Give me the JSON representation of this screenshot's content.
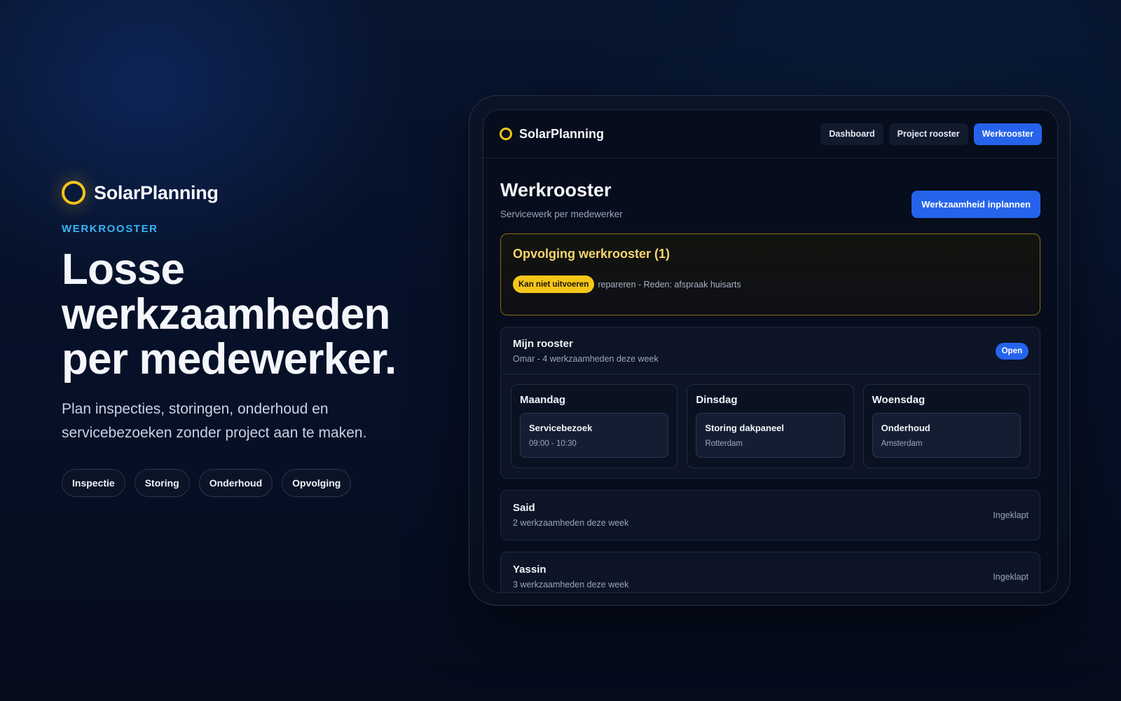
{
  "hero": {
    "brand": "SolarPlanning",
    "eyebrow": "WERKROOSTER",
    "headline": [
      "Losse",
      "werkzaamheden",
      "per medewerker."
    ],
    "lede": "Plan inspecties, storingen, onderhoud en servicebezoeken zonder project aan te maken.",
    "chips": [
      "Inspectie",
      "Storing",
      "Onderhoud",
      "Opvolging"
    ]
  },
  "app": {
    "brand": "SolarPlanning",
    "nav": [
      {
        "label": "Dashboard",
        "active": false
      },
      {
        "label": "Project rooster",
        "active": false
      },
      {
        "label": "Werkrooster",
        "active": true
      }
    ],
    "page": {
      "title": "Werkrooster",
      "subtitle": "Servicewerk per medewerker",
      "primary_action": "Werkzaamheid inplannen"
    },
    "followup": {
      "title": "Opvolging werkrooster (1)",
      "badge": "Kan niet uitvoeren",
      "text": "repareren - Reden: afspraak huisarts"
    },
    "my_schedule": {
      "title": "Mijn rooster",
      "subtitle": "Omar - 4 werkzaamheden deze week",
      "status": "Open",
      "days": [
        {
          "name": "Maandag",
          "task": "Servicebezoek",
          "detail": "09:00 - 10:30"
        },
        {
          "name": "Dinsdag",
          "task": "Storing dakpaneel",
          "detail": "Rotterdam"
        },
        {
          "name": "Woensdag",
          "task": "Onderhoud",
          "detail": "Amsterdam"
        }
      ]
    },
    "employees": [
      {
        "name": "Said",
        "summary": "2 werkzaamheden deze week",
        "state": "Ingeklapt"
      },
      {
        "name": "Yassin",
        "summary": "3 werkzaamheden deze week",
        "state": "Ingeklapt"
      }
    ]
  },
  "colors": {
    "accent_blue": "#2563eb",
    "sun_yellow": "#f5c518",
    "eyebrow_cyan": "#38b6f5"
  }
}
